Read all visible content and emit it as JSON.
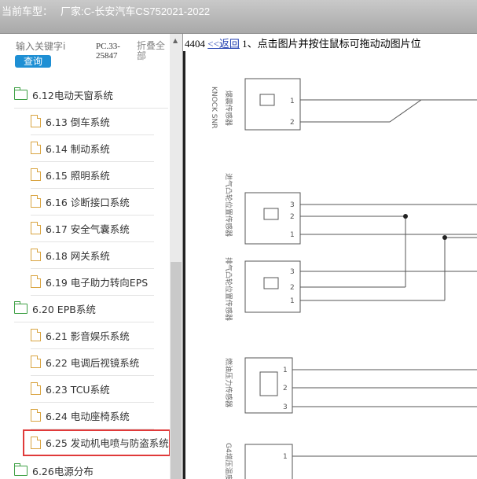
{
  "header": {
    "vehicle_label": "当前车型：",
    "manufacturer_label": "厂家:",
    "vehicle": "C-长安汽车CS752021-2022"
  },
  "search": {
    "placeholder": "输入关键字i",
    "button_label": "查询",
    "pc_code": "PC.33-25847",
    "fold_label": "折叠全部"
  },
  "tree": [
    {
      "label": "6.12电动天窗系统",
      "type": "folder"
    },
    {
      "label": "6.13 倒车系统",
      "type": "doc"
    },
    {
      "label": "6.14 制动系统",
      "type": "doc"
    },
    {
      "label": "6.15 照明系统",
      "type": "doc"
    },
    {
      "label": "6.16 诊断接口系统",
      "type": "doc"
    },
    {
      "label": "6.17 安全气囊系统",
      "type": "doc"
    },
    {
      "label": "6.18 网关系统",
      "type": "doc"
    },
    {
      "label": "6.19 电子助力转向EPS",
      "type": "doc"
    },
    {
      "label": "6.20 EPB系统",
      "type": "folder"
    },
    {
      "label": "6.21 影音娱乐系统",
      "type": "doc"
    },
    {
      "label": "6.22 电调后视镜系统",
      "type": "doc"
    },
    {
      "label": "6.23 TCU系统",
      "type": "doc"
    },
    {
      "label": "6.24 电动座椅系统",
      "type": "doc"
    },
    {
      "label": "6.25 发动机电喷与防盗系统",
      "type": "doc",
      "selected": true
    },
    {
      "label": "6.26电源分布",
      "type": "folder"
    }
  ],
  "content": {
    "page_number": "4404",
    "back_link": "<<返回",
    "instruction": "1、点击图片并按住鼠标可拖动动图片位",
    "diagram": {
      "sensors": [
        {
          "english": "KNOCK SNR",
          "chinese": "爆震传感器",
          "pins": [
            "1",
            "2"
          ]
        },
        {
          "chinese": "进气凸轮位置传感器",
          "pins": [
            "3",
            "2",
            "1"
          ]
        },
        {
          "chinese": "排气凸轮位置传感器",
          "pins": [
            "3",
            "2",
            "1"
          ]
        },
        {
          "chinese": "燃油压力传感器",
          "pins": [
            "1",
            "2",
            "3"
          ]
        },
        {
          "chinese": "G4增压温度/",
          "pins": [
            "1"
          ]
        }
      ]
    }
  },
  "colors": {
    "accent": "#1e8fd4",
    "selection": "#e03a3a",
    "folder": "#3ea044",
    "doc": "#d9a441"
  }
}
